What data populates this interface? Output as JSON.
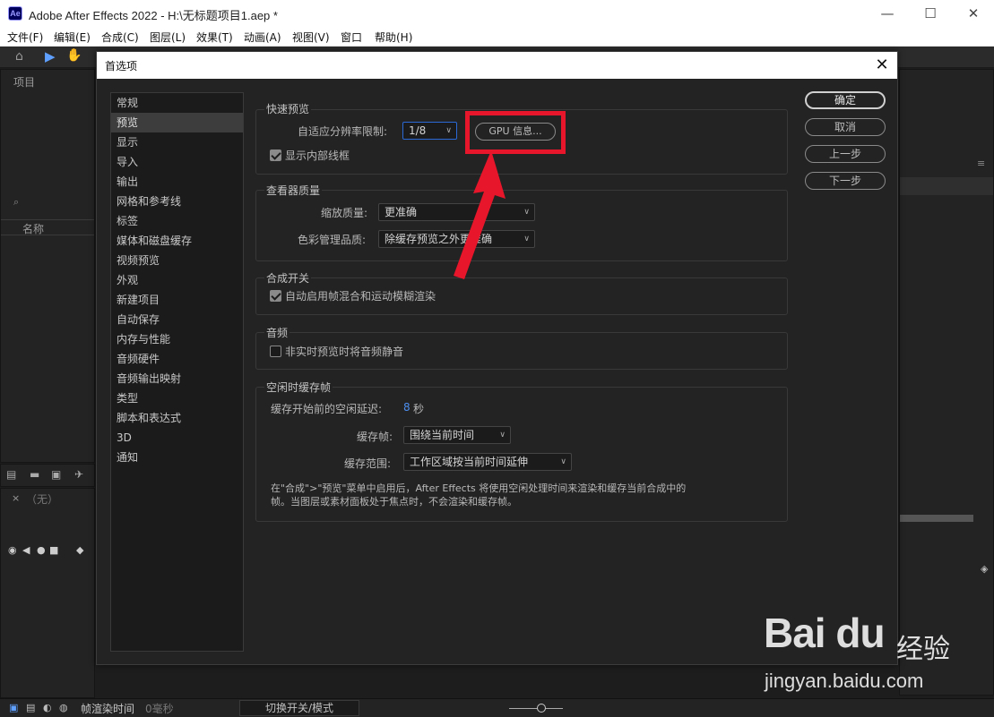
{
  "window": {
    "logo_text": "Ae",
    "title": "Adobe After Effects 2022 - H:\\无标题项目1.aep *",
    "minimize": "—",
    "maximize": "☐",
    "close": "✕"
  },
  "menubar": {
    "items": [
      "文件(F)",
      "编辑(E)",
      "合成(C)",
      "图层(L)",
      "效果(T)",
      "动画(A)",
      "视图(V)",
      "窗口",
      "帮助(H)"
    ]
  },
  "background": {
    "project_tab": "项目",
    "name_column": "名称",
    "comp_tab": "（无）",
    "frame_render_time_label": "帧渲染时间",
    "frame_render_time_value": "0毫秒",
    "toggle_switch_mode": "切换开关/模式"
  },
  "dialog": {
    "title": "首选项",
    "close_glyph": "✕",
    "sidebar": [
      "常规",
      "预览",
      "显示",
      "导入",
      "输出",
      "网格和参考线",
      "标签",
      "媒体和磁盘缓存",
      "视频预览",
      "外观",
      "新建项目",
      "自动保存",
      "内存与性能",
      "音频硬件",
      "音频输出映射",
      "类型",
      "脚本和表达式",
      "3D",
      "通知"
    ],
    "selected_index": 1,
    "buttons": {
      "ok": "确定",
      "cancel": "取消",
      "previous": "上一步",
      "next": "下一步"
    },
    "fast_preview": {
      "title": "快速预览",
      "adaptive_label": "自适应分辨率限制:",
      "adaptive_value": "1/8",
      "gpu_button": "GPU 信息...",
      "show_wireframe_label": "显示内部线框",
      "show_wireframe_checked": true
    },
    "viewer_quality": {
      "title": "查看器质量",
      "zoom_label": "缩放质量:",
      "zoom_value": "更准确",
      "color_label": "色彩管理品质:",
      "color_value": "除缓存预览之外更准确"
    },
    "comp_switches": {
      "title": "合成开关",
      "auto_enable_label": "自动启用帧混合和运动模糊渲染",
      "auto_enable_checked": true
    },
    "audio": {
      "title": "音频",
      "mute_label": "非实时预览时将音频静音",
      "mute_checked": false
    },
    "idle_cache": {
      "title": "空闲时缓存帧",
      "delay_label": "缓存开始前的空闲延迟:",
      "delay_value": "8",
      "delay_unit": "秒",
      "cache_frames_label": "缓存帧:",
      "cache_frames_value": "围绕当前时间",
      "cache_range_label": "缓存范围:",
      "cache_range_value": "工作区域按当前时间延伸",
      "note_line1": "在\"合成\">\"预览\"菜单中启用后，After Effects 将使用空闲处理时间来渲染和缓存当前合成中的",
      "note_line2": "帧。当图层或素材面板处于焦点时，不会渲染和缓存帧。"
    }
  },
  "watermark": {
    "logo": "Bai du",
    "cn": "经验",
    "url": "jingyan.baidu.com"
  },
  "colors": {
    "highlight_red": "#e8162a",
    "accent_blue": "#4d8ff0",
    "panel_bg": "#232323"
  }
}
